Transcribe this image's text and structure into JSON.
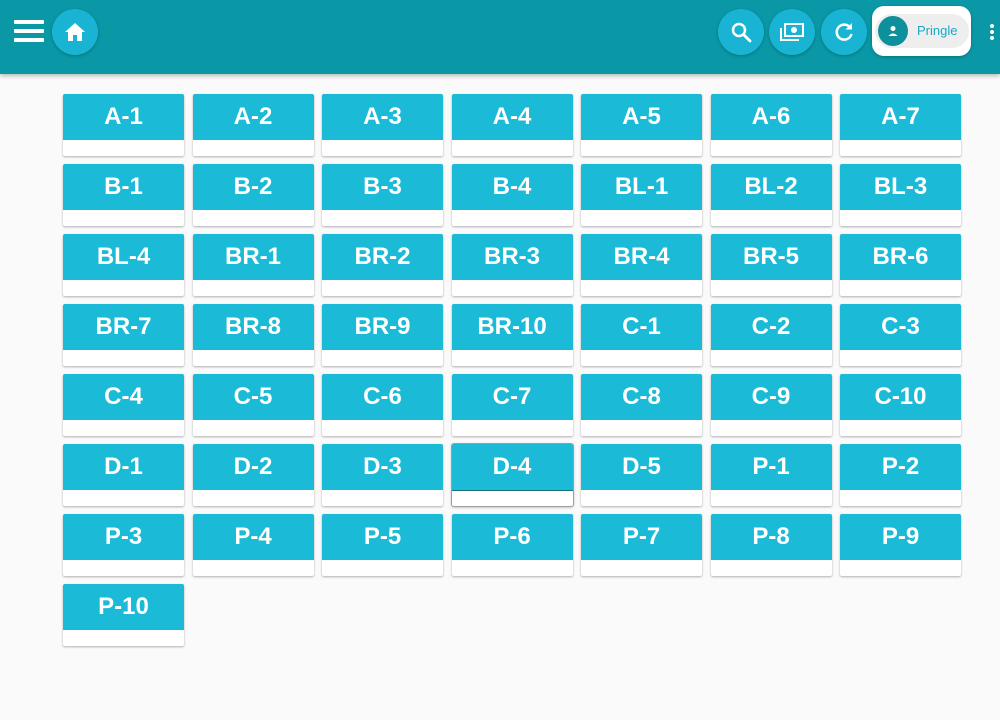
{
  "header": {
    "icons": {
      "menu": "hamburger-menu-icon",
      "home": "home-icon",
      "search": "search-icon",
      "money": "money-bill-icon",
      "refresh": "refresh-icon",
      "user": "person-icon",
      "more": "more-vertical-icon"
    },
    "user_name": "Pringle"
  },
  "colors": {
    "topbar": "#0a98a6",
    "tile": "#1bbad6",
    "round_button": "#19b4d3"
  },
  "tables": [
    {
      "label": "A-1"
    },
    {
      "label": "A-2"
    },
    {
      "label": "A-3"
    },
    {
      "label": "A-4"
    },
    {
      "label": "A-5"
    },
    {
      "label": "A-6"
    },
    {
      "label": "A-7"
    },
    {
      "label": "B-1"
    },
    {
      "label": "B-2"
    },
    {
      "label": "B-3"
    },
    {
      "label": "B-4"
    },
    {
      "label": "BL-1"
    },
    {
      "label": "BL-2"
    },
    {
      "label": "BL-3"
    },
    {
      "label": "BL-4"
    },
    {
      "label": "BR-1"
    },
    {
      "label": "BR-2"
    },
    {
      "label": "BR-3"
    },
    {
      "label": "BR-4"
    },
    {
      "label": "BR-5"
    },
    {
      "label": "BR-6"
    },
    {
      "label": "BR-7"
    },
    {
      "label": "BR-8"
    },
    {
      "label": "BR-9"
    },
    {
      "label": "BR-10"
    },
    {
      "label": "C-1"
    },
    {
      "label": "C-2"
    },
    {
      "label": "C-3"
    },
    {
      "label": "C-4"
    },
    {
      "label": "C-5"
    },
    {
      "label": "C-6"
    },
    {
      "label": "C-7"
    },
    {
      "label": "C-8"
    },
    {
      "label": "C-9"
    },
    {
      "label": "C-10"
    },
    {
      "label": "D-1"
    },
    {
      "label": "D-2"
    },
    {
      "label": "D-3"
    },
    {
      "label": "D-4",
      "selected": true
    },
    {
      "label": "D-5"
    },
    {
      "label": "P-1"
    },
    {
      "label": "P-2"
    },
    {
      "label": "P-3"
    },
    {
      "label": "P-4"
    },
    {
      "label": "P-5"
    },
    {
      "label": "P-6"
    },
    {
      "label": "P-7"
    },
    {
      "label": "P-8"
    },
    {
      "label": "P-9"
    },
    {
      "label": "P-10"
    }
  ]
}
